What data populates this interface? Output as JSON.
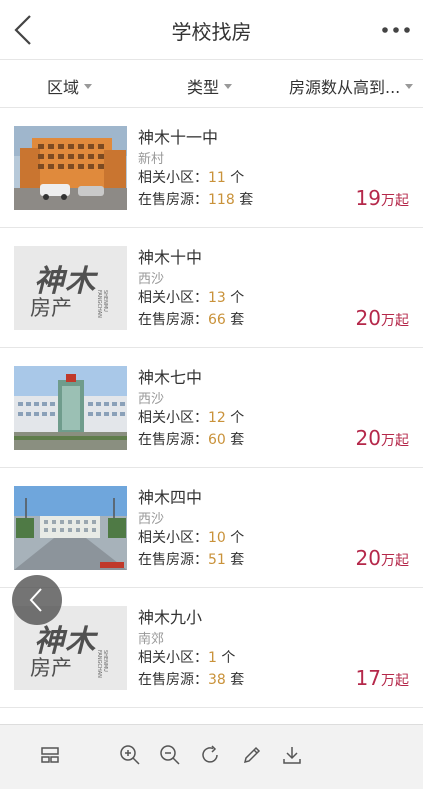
{
  "header": {
    "title": "学校找房",
    "back_icon": "chevron-left-icon",
    "more_icon": "more-dots-icon"
  },
  "filters": [
    {
      "label": "区域"
    },
    {
      "label": "类型"
    },
    {
      "label": "房源数从高到..."
    }
  ],
  "labels": {
    "related": "相关小区：",
    "related_unit": "个",
    "onsale": "在售房源：",
    "onsale_unit": "套",
    "price_unit": "万起"
  },
  "schools": [
    {
      "name": "神木十一中",
      "area": "新村",
      "related": "11",
      "onsale": "118",
      "price": "19"
    },
    {
      "name": "神木十中",
      "area": "西沙",
      "related": "13",
      "onsale": "66",
      "price": "20"
    },
    {
      "name": "神木七中",
      "area": "西沙",
      "related": "12",
      "onsale": "60",
      "price": "20"
    },
    {
      "name": "神木四中",
      "area": "西沙",
      "related": "10",
      "onsale": "51",
      "price": "20"
    },
    {
      "name": "神木九小",
      "area": "南郊",
      "related": "1",
      "onsale": "38",
      "price": "17"
    }
  ],
  "placeholder_logo": {
    "top": "神木",
    "bottom": "房产",
    "vertical": "SHENMU FANGCHAN"
  },
  "toolbar": {
    "icons": [
      "layout-icon",
      "zoom-in-icon",
      "zoom-out-icon",
      "rotate-icon",
      "pen-icon",
      "download-icon"
    ]
  },
  "colors": {
    "price": "#b5284a",
    "count": "#c9923a",
    "muted": "#999999"
  }
}
